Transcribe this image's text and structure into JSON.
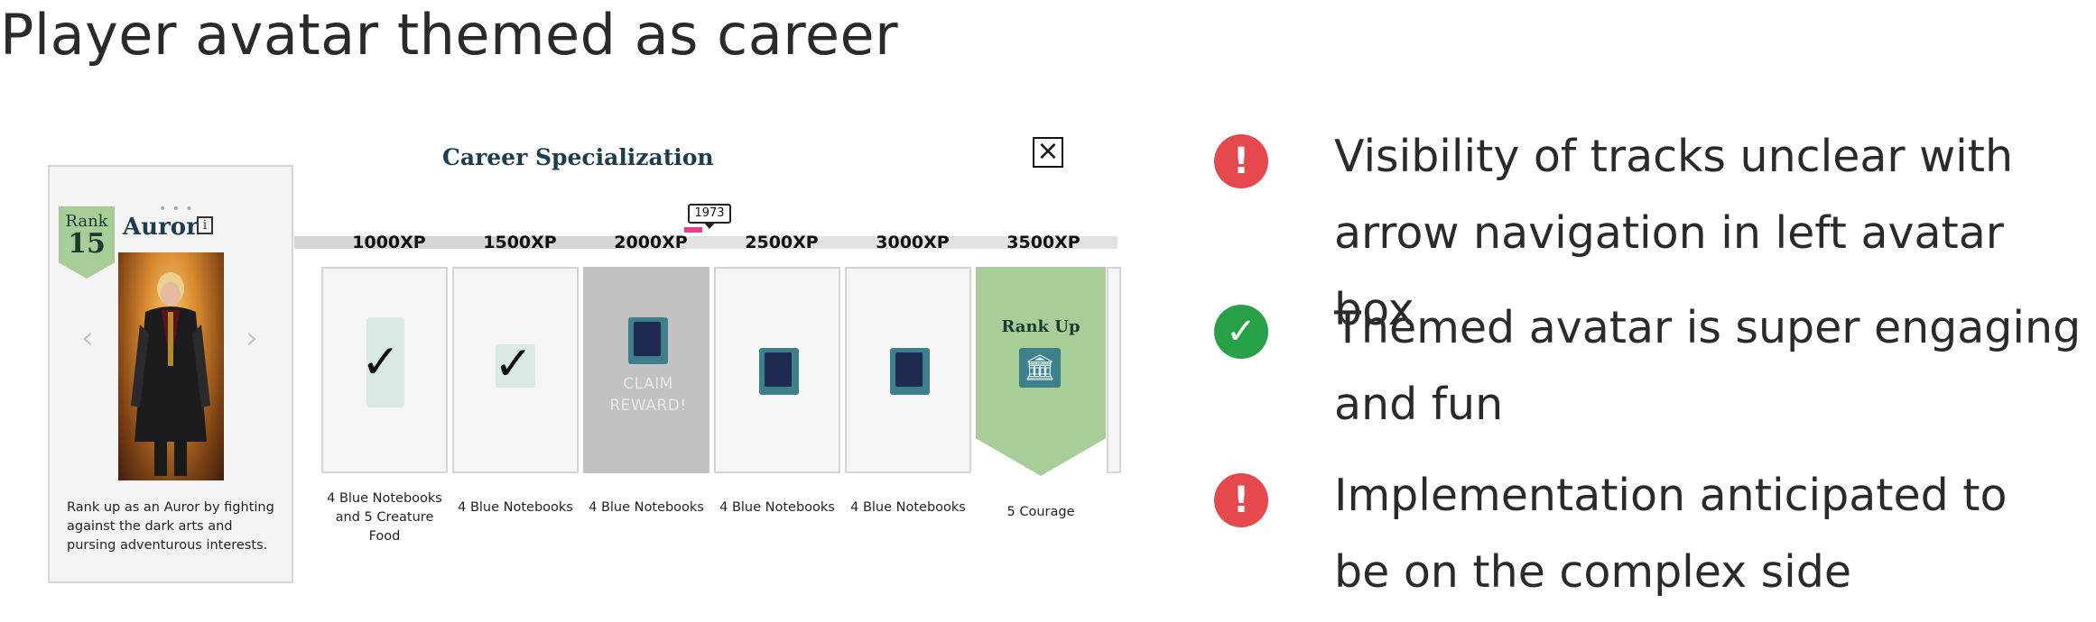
{
  "title": "Player avatar themed as career",
  "mockup": {
    "rank_label": "Rank",
    "rank_number": "15",
    "career_name": "Auror",
    "info_icon": "i",
    "avatar_description": "Rank up as an Auror by fighting against the dark arts and pursing adventurous interests.",
    "track_title": "Career Specialization",
    "current_xp_marker": "1973",
    "claim_text": "CLAIM REWARD!",
    "rank_up_label": "Rank Up",
    "milestones": [
      {
        "xp": "1000XP",
        "reward": "4 Blue Notebooks and 5 Creature Food",
        "state": "claimed"
      },
      {
        "xp": "1500XP",
        "reward": "4 Blue Notebooks",
        "state": "claimed"
      },
      {
        "xp": "2000XP",
        "reward": "4 Blue Notebooks",
        "state": "claimable"
      },
      {
        "xp": "2500XP",
        "reward": "4 Blue Notebooks",
        "state": "locked"
      },
      {
        "xp": "3000XP",
        "reward": "4 Blue Notebooks",
        "state": "locked"
      },
      {
        "xp": "3500XP",
        "reward": "5 Courage",
        "state": "rank_up"
      }
    ],
    "icons": {
      "close": "close-icon",
      "prev": "chevron-left-icon",
      "next": "chevron-right-icon",
      "claimed": "checkmark-icon",
      "notebook": "notebook-icon",
      "courage": "courage-icon"
    },
    "colors": {
      "rank_green": "#a9cd98",
      "claim_gray": "#c2c2c2",
      "title_navy": "#1d3c4d"
    }
  },
  "feedback": [
    {
      "status": "warning",
      "icon": "exclamation-icon",
      "color": "#e5484d",
      "line1": "Visibility of tracks unclear with",
      "line2": "arrow navigation in left avatar box"
    },
    {
      "status": "positive",
      "icon": "check-icon",
      "color": "#27a047",
      "line1": "Themed avatar is super engaging",
      "line2": "and fun"
    },
    {
      "status": "warning",
      "icon": "exclamation-icon",
      "color": "#e5484d",
      "line1": "Implementation anticipated to",
      "line2": "be on the complex side"
    }
  ]
}
